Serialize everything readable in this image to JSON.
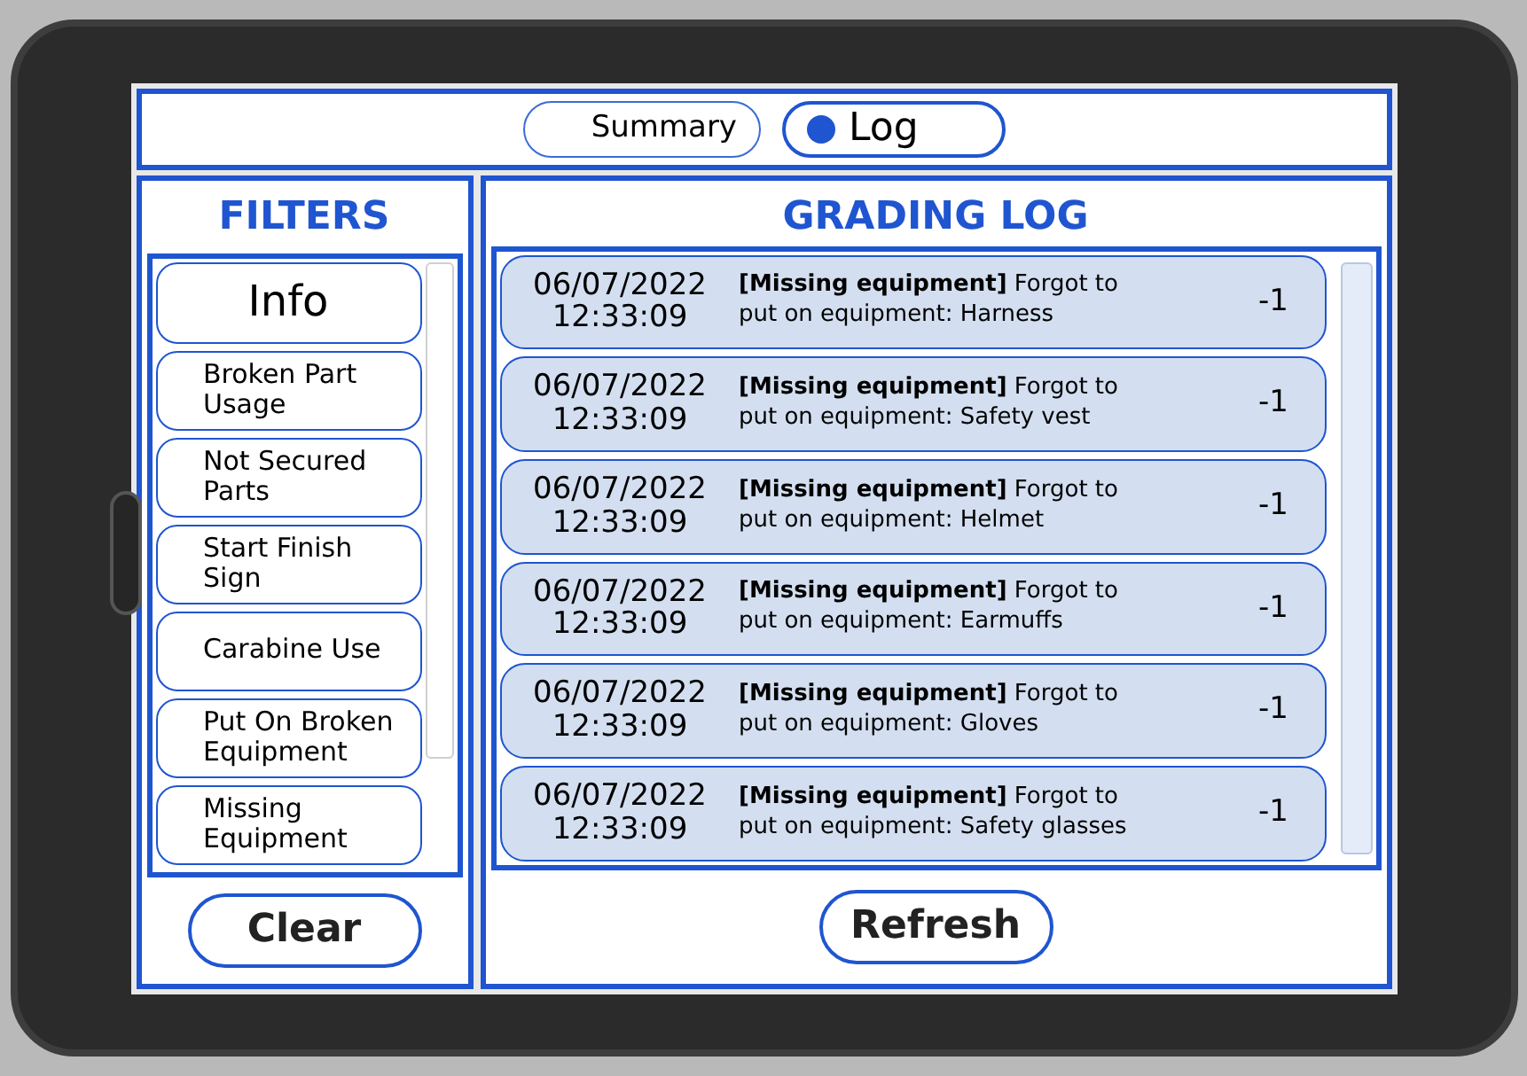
{
  "tabs": [
    {
      "label": "Summary",
      "selected": false
    },
    {
      "label": "Log",
      "selected": true
    }
  ],
  "filters": {
    "title": "FILTERS",
    "items": [
      {
        "label": "Info",
        "kind": "header"
      },
      {
        "label": "Broken Part Usage",
        "kind": "filter"
      },
      {
        "label": "Not Secured Parts",
        "kind": "filter"
      },
      {
        "label": "Start Finish Sign",
        "kind": "filter"
      },
      {
        "label": "Carabine Use",
        "kind": "filter"
      },
      {
        "label": "Put On Broken Equipment",
        "kind": "filter"
      },
      {
        "label": "Missing Equipment",
        "kind": "filter"
      }
    ],
    "button": "Clear"
  },
  "log": {
    "title": "GRADING LOG",
    "entries": [
      {
        "date": "06/07/2022",
        "time": "12:33:09",
        "message": "**[Missing equipment]** Forgot to put on equipment: Harness",
        "score": "-1"
      },
      {
        "date": "06/07/2022",
        "time": "12:33:09",
        "message": "**[Missing equipment]** Forgot to put on equipment: Safety vest",
        "score": "-1"
      },
      {
        "date": "06/07/2022",
        "time": "12:33:09",
        "message": "**[Missing equipment]** Forgot to put on equipment: Helmet",
        "score": "-1"
      },
      {
        "date": "06/07/2022",
        "time": "12:33:09",
        "message": "**[Missing equipment]** Forgot to put on equipment: Earmuffs",
        "score": "-1"
      },
      {
        "date": "06/07/2022",
        "time": "12:33:09",
        "message": "**[Missing equipment]** Forgot to put on equipment: Gloves",
        "score": "-1"
      },
      {
        "date": "06/07/2022",
        "time": "12:33:09",
        "message": "**[Missing equipment]** Forgot to put on equipment: Safety glasses",
        "score": "-1"
      }
    ],
    "button": "Refresh"
  }
}
